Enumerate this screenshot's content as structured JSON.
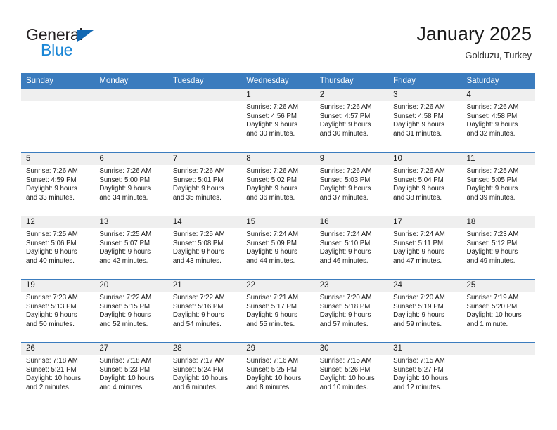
{
  "brand": {
    "name_top": "General",
    "name_bottom": "Blue",
    "triangle_color": "#1268b3",
    "blue_color": "#1a86d6"
  },
  "header": {
    "title": "January 2025",
    "subtitle": "Golduzu, Turkey"
  },
  "theme": {
    "header_blue": "#3b7cbe",
    "day_number_bg": "#efefef",
    "text": "#1a1a1a",
    "page_bg": "#ffffff"
  },
  "weekdays": [
    "Sunday",
    "Monday",
    "Tuesday",
    "Wednesday",
    "Thursday",
    "Friday",
    "Saturday"
  ],
  "labels": {
    "sunrise_prefix": "Sunrise:",
    "sunset_prefix": "Sunset:",
    "daylight_prefix": "Daylight:"
  },
  "weeks": [
    [
      {
        "day": "",
        "empty": true
      },
      {
        "day": "",
        "empty": true
      },
      {
        "day": "",
        "empty": true
      },
      {
        "day": "1",
        "sunrise": "Sunrise: 7:26 AM",
        "sunset": "Sunset: 4:56 PM",
        "daylight_1": "Daylight: 9 hours",
        "daylight_2": "and 30 minutes."
      },
      {
        "day": "2",
        "sunrise": "Sunrise: 7:26 AM",
        "sunset": "Sunset: 4:57 PM",
        "daylight_1": "Daylight: 9 hours",
        "daylight_2": "and 30 minutes."
      },
      {
        "day": "3",
        "sunrise": "Sunrise: 7:26 AM",
        "sunset": "Sunset: 4:58 PM",
        "daylight_1": "Daylight: 9 hours",
        "daylight_2": "and 31 minutes."
      },
      {
        "day": "4",
        "sunrise": "Sunrise: 7:26 AM",
        "sunset": "Sunset: 4:58 PM",
        "daylight_1": "Daylight: 9 hours",
        "daylight_2": "and 32 minutes."
      }
    ],
    [
      {
        "day": "5",
        "sunrise": "Sunrise: 7:26 AM",
        "sunset": "Sunset: 4:59 PM",
        "daylight_1": "Daylight: 9 hours",
        "daylight_2": "and 33 minutes."
      },
      {
        "day": "6",
        "sunrise": "Sunrise: 7:26 AM",
        "sunset": "Sunset: 5:00 PM",
        "daylight_1": "Daylight: 9 hours",
        "daylight_2": "and 34 minutes."
      },
      {
        "day": "7",
        "sunrise": "Sunrise: 7:26 AM",
        "sunset": "Sunset: 5:01 PM",
        "daylight_1": "Daylight: 9 hours",
        "daylight_2": "and 35 minutes."
      },
      {
        "day": "8",
        "sunrise": "Sunrise: 7:26 AM",
        "sunset": "Sunset: 5:02 PM",
        "daylight_1": "Daylight: 9 hours",
        "daylight_2": "and 36 minutes."
      },
      {
        "day": "9",
        "sunrise": "Sunrise: 7:26 AM",
        "sunset": "Sunset: 5:03 PM",
        "daylight_1": "Daylight: 9 hours",
        "daylight_2": "and 37 minutes."
      },
      {
        "day": "10",
        "sunrise": "Sunrise: 7:26 AM",
        "sunset": "Sunset: 5:04 PM",
        "daylight_1": "Daylight: 9 hours",
        "daylight_2": "and 38 minutes."
      },
      {
        "day": "11",
        "sunrise": "Sunrise: 7:25 AM",
        "sunset": "Sunset: 5:05 PM",
        "daylight_1": "Daylight: 9 hours",
        "daylight_2": "and 39 minutes."
      }
    ],
    [
      {
        "day": "12",
        "sunrise": "Sunrise: 7:25 AM",
        "sunset": "Sunset: 5:06 PM",
        "daylight_1": "Daylight: 9 hours",
        "daylight_2": "and 40 minutes."
      },
      {
        "day": "13",
        "sunrise": "Sunrise: 7:25 AM",
        "sunset": "Sunset: 5:07 PM",
        "daylight_1": "Daylight: 9 hours",
        "daylight_2": "and 42 minutes."
      },
      {
        "day": "14",
        "sunrise": "Sunrise: 7:25 AM",
        "sunset": "Sunset: 5:08 PM",
        "daylight_1": "Daylight: 9 hours",
        "daylight_2": "and 43 minutes."
      },
      {
        "day": "15",
        "sunrise": "Sunrise: 7:24 AM",
        "sunset": "Sunset: 5:09 PM",
        "daylight_1": "Daylight: 9 hours",
        "daylight_2": "and 44 minutes."
      },
      {
        "day": "16",
        "sunrise": "Sunrise: 7:24 AM",
        "sunset": "Sunset: 5:10 PM",
        "daylight_1": "Daylight: 9 hours",
        "daylight_2": "and 46 minutes."
      },
      {
        "day": "17",
        "sunrise": "Sunrise: 7:24 AM",
        "sunset": "Sunset: 5:11 PM",
        "daylight_1": "Daylight: 9 hours",
        "daylight_2": "and 47 minutes."
      },
      {
        "day": "18",
        "sunrise": "Sunrise: 7:23 AM",
        "sunset": "Sunset: 5:12 PM",
        "daylight_1": "Daylight: 9 hours",
        "daylight_2": "and 49 minutes."
      }
    ],
    [
      {
        "day": "19",
        "sunrise": "Sunrise: 7:23 AM",
        "sunset": "Sunset: 5:13 PM",
        "daylight_1": "Daylight: 9 hours",
        "daylight_2": "and 50 minutes."
      },
      {
        "day": "20",
        "sunrise": "Sunrise: 7:22 AM",
        "sunset": "Sunset: 5:15 PM",
        "daylight_1": "Daylight: 9 hours",
        "daylight_2": "and 52 minutes."
      },
      {
        "day": "21",
        "sunrise": "Sunrise: 7:22 AM",
        "sunset": "Sunset: 5:16 PM",
        "daylight_1": "Daylight: 9 hours",
        "daylight_2": "and 54 minutes."
      },
      {
        "day": "22",
        "sunrise": "Sunrise: 7:21 AM",
        "sunset": "Sunset: 5:17 PM",
        "daylight_1": "Daylight: 9 hours",
        "daylight_2": "and 55 minutes."
      },
      {
        "day": "23",
        "sunrise": "Sunrise: 7:20 AM",
        "sunset": "Sunset: 5:18 PM",
        "daylight_1": "Daylight: 9 hours",
        "daylight_2": "and 57 minutes."
      },
      {
        "day": "24",
        "sunrise": "Sunrise: 7:20 AM",
        "sunset": "Sunset: 5:19 PM",
        "daylight_1": "Daylight: 9 hours",
        "daylight_2": "and 59 minutes."
      },
      {
        "day": "25",
        "sunrise": "Sunrise: 7:19 AM",
        "sunset": "Sunset: 5:20 PM",
        "daylight_1": "Daylight: 10 hours",
        "daylight_2": "and 1 minute."
      }
    ],
    [
      {
        "day": "26",
        "sunrise": "Sunrise: 7:18 AM",
        "sunset": "Sunset: 5:21 PM",
        "daylight_1": "Daylight: 10 hours",
        "daylight_2": "and 2 minutes."
      },
      {
        "day": "27",
        "sunrise": "Sunrise: 7:18 AM",
        "sunset": "Sunset: 5:23 PM",
        "daylight_1": "Daylight: 10 hours",
        "daylight_2": "and 4 minutes."
      },
      {
        "day": "28",
        "sunrise": "Sunrise: 7:17 AM",
        "sunset": "Sunset: 5:24 PM",
        "daylight_1": "Daylight: 10 hours",
        "daylight_2": "and 6 minutes."
      },
      {
        "day": "29",
        "sunrise": "Sunrise: 7:16 AM",
        "sunset": "Sunset: 5:25 PM",
        "daylight_1": "Daylight: 10 hours",
        "daylight_2": "and 8 minutes."
      },
      {
        "day": "30",
        "sunrise": "Sunrise: 7:15 AM",
        "sunset": "Sunset: 5:26 PM",
        "daylight_1": "Daylight: 10 hours",
        "daylight_2": "and 10 minutes."
      },
      {
        "day": "31",
        "sunrise": "Sunrise: 7:15 AM",
        "sunset": "Sunset: 5:27 PM",
        "daylight_1": "Daylight: 10 hours",
        "daylight_2": "and 12 minutes."
      },
      {
        "day": "",
        "empty": true
      }
    ]
  ]
}
